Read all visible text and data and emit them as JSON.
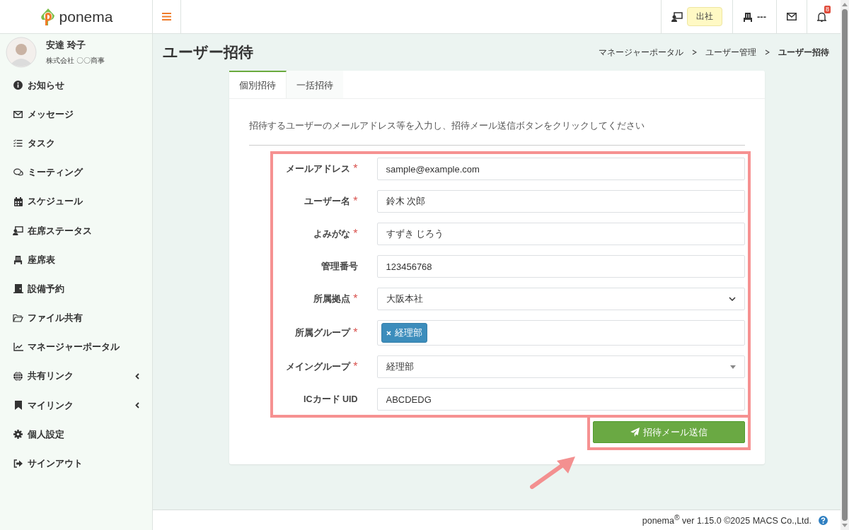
{
  "header": {
    "logo": "ponema",
    "status_label": "出社",
    "seat_label": "---",
    "notification_count": "8"
  },
  "user": {
    "name": "安達 玲子",
    "company": "株式会社 〇〇商事"
  },
  "sidebar": {
    "items": [
      {
        "label": "お知らせ",
        "submenu": false
      },
      {
        "label": "メッセージ",
        "submenu": false
      },
      {
        "label": "タスク",
        "submenu": false
      },
      {
        "label": "ミーティング",
        "submenu": false
      },
      {
        "label": "スケジュール",
        "submenu": false
      },
      {
        "label": "在席ステータス",
        "submenu": false
      },
      {
        "label": "座席表",
        "submenu": false
      },
      {
        "label": "設備予約",
        "submenu": false
      },
      {
        "label": "ファイル共有",
        "submenu": false
      },
      {
        "label": "マネージャーポータル",
        "submenu": false
      },
      {
        "label": "共有リンク",
        "submenu": true
      },
      {
        "label": "マイリンク",
        "submenu": true
      },
      {
        "label": "個人設定",
        "submenu": false
      },
      {
        "label": "サインアウト",
        "submenu": false
      }
    ]
  },
  "page": {
    "title": "ユーザー招待",
    "breadcrumb": [
      {
        "label": "マネージャーポータル",
        "current": false
      },
      {
        "label": "ユーザー管理",
        "current": false
      },
      {
        "label": "ユーザー招待",
        "current": true
      }
    ]
  },
  "tabs": [
    {
      "label": "個別招待",
      "selected": true
    },
    {
      "label": "一括招待",
      "selected": false
    }
  ],
  "description": "招待するユーザーのメールアドレス等を入力し、招待メール送信ボタンをクリックしてください",
  "form": {
    "fields": [
      {
        "kind": "text",
        "label": "メールアドレス",
        "required_mark": "*",
        "value": "sample@example.com"
      },
      {
        "kind": "text",
        "label": "ユーザー名",
        "required_mark": "*",
        "value": "鈴木 次郎"
      },
      {
        "kind": "text",
        "label": "よみがな",
        "required_mark": "*",
        "value": "すずき じろう"
      },
      {
        "kind": "text",
        "label": "管理番号",
        "value": "123456768"
      },
      {
        "kind": "select",
        "label": "所属拠点",
        "required_mark": "*",
        "value": "大阪本社"
      },
      {
        "kind": "tags",
        "label": "所属グループ",
        "required_mark": "*",
        "tags": [
          "経理部"
        ]
      },
      {
        "kind": "combo",
        "label": "メイングループ",
        "required_mark": "*",
        "value": "経理部"
      },
      {
        "kind": "text",
        "label": "ICカード UID",
        "value": "ABCDEDG"
      }
    ],
    "submit": "招待メール送信"
  },
  "footer": {
    "text": "ponema$^{®}$ ver 1.15.0 ©2025 MACS Co.,Ltd."
  }
}
